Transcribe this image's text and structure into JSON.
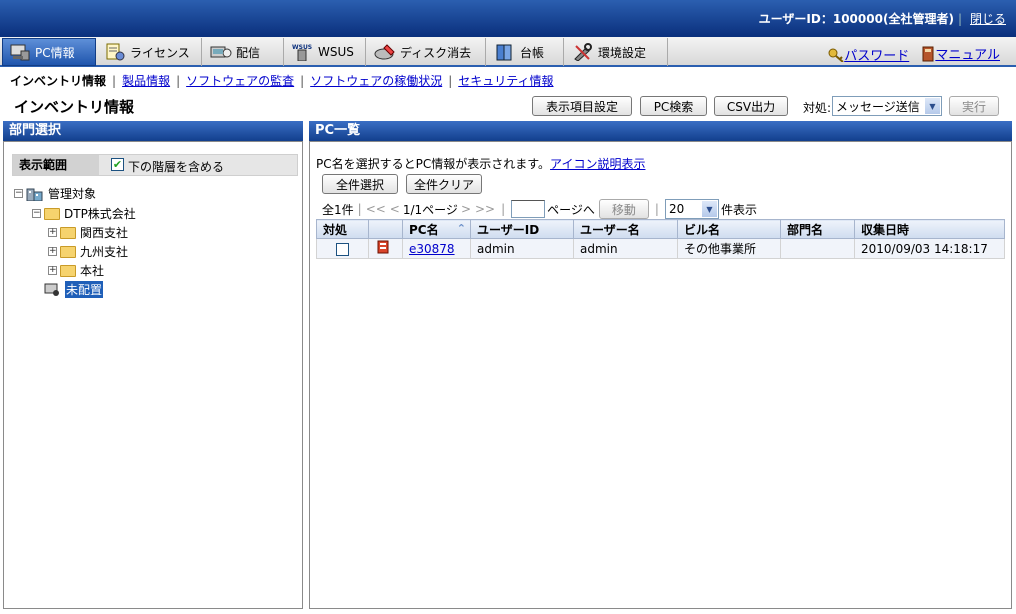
{
  "header": {
    "user_label": "ユーザーID：100000(全社管理者)",
    "close_link": "閉じる"
  },
  "tabs": [
    {
      "label": "PC情報",
      "icon": "pc-icon",
      "active": true
    },
    {
      "label": "ライセンス",
      "icon": "license-icon",
      "active": false
    },
    {
      "label": "配信",
      "icon": "delivery-icon",
      "active": false
    },
    {
      "label": "WSUS",
      "icon": "wsus-icon",
      "active": false
    },
    {
      "label": "ディスク消去",
      "icon": "disk-erase-icon",
      "active": false
    },
    {
      "label": "台帳",
      "icon": "ledger-icon",
      "active": false
    },
    {
      "label": "環境設定",
      "icon": "settings-icon",
      "active": false
    }
  ],
  "top_links": {
    "password": "パスワード",
    "manual": "マニュアル"
  },
  "subnav": [
    {
      "label": "インベントリ情報",
      "current": true
    },
    {
      "label": "製品情報",
      "current": false
    },
    {
      "label": "ソフトウェアの監査",
      "current": false
    },
    {
      "label": "ソフトウェアの稼働状況",
      "current": false
    },
    {
      "label": "セキュリティ情報",
      "current": false
    }
  ],
  "page": {
    "title": "インベントリ情報",
    "btn_columns": "表示項目設定",
    "btn_pc_search": "PC検索",
    "btn_csv": "CSV出力",
    "action_label": "対処:",
    "action_value": "メッセージ送信",
    "btn_execute": "実行"
  },
  "dept_panel": {
    "title": "部門選択",
    "scope_label": "表示範囲",
    "include_sub_label": "下の階層を含める",
    "include_sub_checked": true,
    "tree": {
      "root": "管理対象",
      "company": "DTP株式会社",
      "branches": [
        "関西支社",
        "九州支社",
        "本社"
      ],
      "unassigned": "未配置"
    }
  },
  "pc_panel": {
    "title": "PC一覧",
    "hint_text": "PC名を選択するとPC情報が表示されます。",
    "icon_help_link": "アイコン説明表示",
    "btn_select_all": "全件選択",
    "btn_clear_all": "全件クリア",
    "count": "全1件",
    "pager_first": "<<",
    "pager_prev": "<",
    "page_info": "1/1ページ",
    "pager_next": ">",
    "pager_last": ">>",
    "page_input": "",
    "page_goto_label": "ページへ",
    "btn_move": "移動",
    "per_page": "20",
    "per_page_suffix": "件表示",
    "columns": [
      "対処",
      "",
      "PC名",
      "ユーザーID",
      "ユーザー名",
      "ビル名",
      "部門名",
      "収集日時"
    ],
    "rows": [
      {
        "checked": false,
        "pc_name": "e30878",
        "user_id": "admin",
        "user_name": "admin",
        "building": "その他事業所",
        "dept": "",
        "collected": "2010/09/03 14:18:17"
      }
    ]
  }
}
